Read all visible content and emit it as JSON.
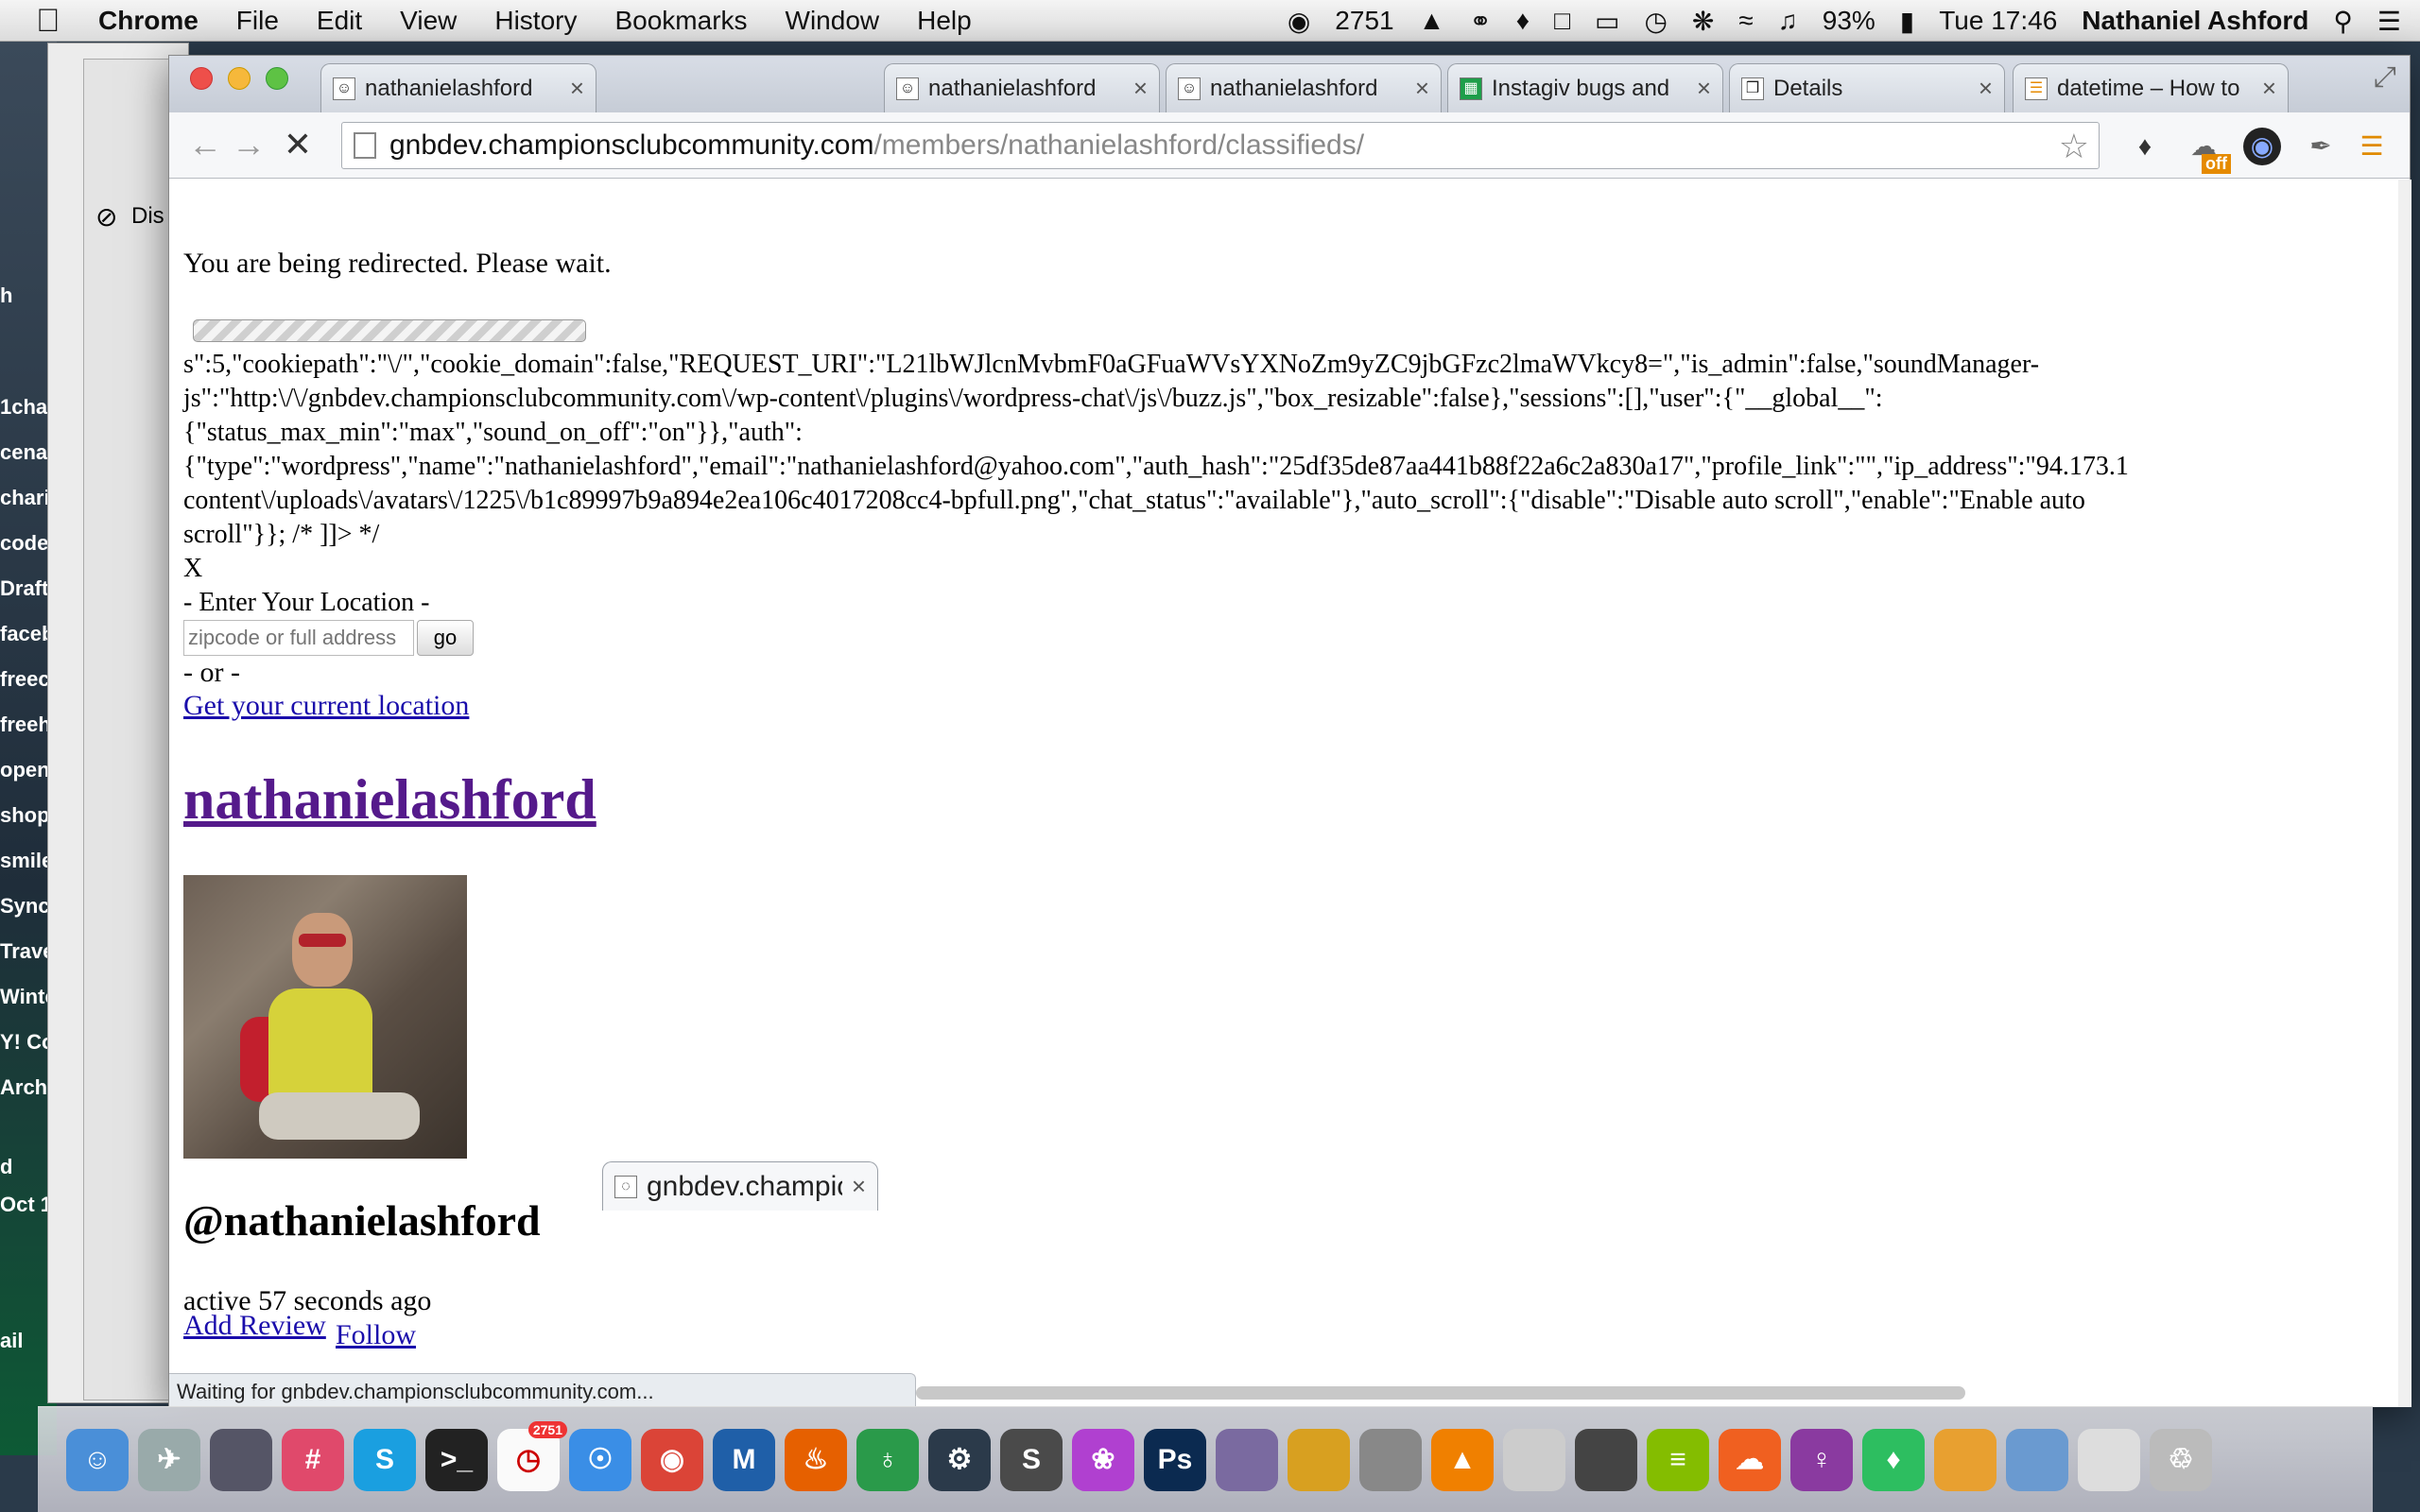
{
  "menubar": {
    "app": "Chrome",
    "items": [
      "File",
      "Edit",
      "View",
      "History",
      "Bookmarks",
      "Window",
      "Help"
    ],
    "status_count": "2751",
    "battery": "93%",
    "clock": "Tue 17:46",
    "user": "Nathaniel Ashford"
  },
  "sidebar_labels": [
    "h",
    "1cha",
    "cena",
    "chari",
    "code",
    "Draft",
    "faceb",
    "freec",
    "freeh",
    "open",
    "shop",
    "smile",
    "Sync",
    "Trave",
    "Winte",
    "Y! Co",
    "Arch",
    "d",
    "Oct 1",
    "ail"
  ],
  "back_window_text": "Dis",
  "tabs": [
    {
      "title": "nathanielashford",
      "icon": "person-icon",
      "active": false
    },
    {
      "title": "gnbdev.champion",
      "icon": "loading-icon",
      "active": true
    },
    {
      "title": "nathanielashford",
      "icon": "person-icon",
      "active": false
    },
    {
      "title": "nathanielashford",
      "icon": "person-icon",
      "active": false
    },
    {
      "title": "Instagiv bugs and",
      "icon": "sheets-icon",
      "active": false
    },
    {
      "title": "Details",
      "icon": "document-icon",
      "active": false
    },
    {
      "title": "datetime – How to",
      "icon": "stackoverflow-icon",
      "active": false
    }
  ],
  "address": {
    "host": "gnbdev.championsclubcommunity.com",
    "path": "/members/nathanielashford/classifieds/"
  },
  "extension_badge": "off",
  "page": {
    "redirect_message": "You are being redirected. Please wait.",
    "code_lines": [
      "s\":5,\"cookiepath\":\"\\/\",\"cookie_domain\":false,\"REQUEST_URI\":\"L21lbWJlcnMvbmF0aGFuaWVsYXNoZm9yZC9jbGFzc2lmaWVkcy8=\",\"is_admin\":false,\"soundManager-",
      "js\":\"http:\\/\\/gnbdev.championsclubcommunity.com\\/wp-content\\/plugins\\/wordpress-chat\\/js\\/buzz.js\",\"box_resizable\":false},\"sessions\":[],\"user\":{\"__global__\":",
      "{\"status_max_min\":\"max\",\"sound_on_off\":\"on\"}},\"auth\":",
      "{\"type\":\"wordpress\",\"name\":\"nathanielashford\",\"email\":\"nathanielashford@yahoo.com\",\"auth_hash\":\"25df35de87aa441b88f22a6c2a830a17\",\"profile_link\":\"\",\"ip_address\":\"94.173.1",
      "content\\/uploads\\/avatars\\/1225\\/b1c89997b9a894e2ea106c4017208cc4-bpfull.png\",\"chat_status\":\"available\"},\"auto_scroll\":{\"disable\":\"Disable auto scroll\",\"enable\":\"Enable auto",
      "scroll\"}}; /* ]]> */"
    ],
    "close_x": "X",
    "location_heading": "- Enter Your Location -",
    "location_placeholder": "zipcode or full address",
    "go_label": "go",
    "or_text": "- or -",
    "current_location_link": "Get your current location",
    "username": "nathanielashford",
    "handle": "@nathanielashford",
    "active_text": "active 57 seconds ago",
    "add_review": "Add Review",
    "follow": "Follow"
  },
  "status_bar": "Waiting for gnbdev.championsclubcommunity.com...",
  "dock_badge": "2751",
  "dock_apps": [
    "finder-icon",
    "launchpad-icon",
    "app-icon",
    "slack-icon",
    "skype-icon",
    "terminal-icon",
    "calendar-icon",
    "safari-icon",
    "chrome-icon",
    "maxthon-icon",
    "firefox-icon",
    "globe-icon",
    "settings-icon",
    "sublime-icon",
    "flower-icon",
    "photoshop-icon",
    "preview-icon",
    "transmit-icon",
    "joystick-icon",
    "vlc-icon",
    "phone-icon",
    "sync-icon",
    "spotify-icon",
    "cloud-icon",
    "venus-icon",
    "evernote-icon",
    "pages-icon",
    "photo-icon",
    "document-stack-icon",
    "trash-icon"
  ]
}
